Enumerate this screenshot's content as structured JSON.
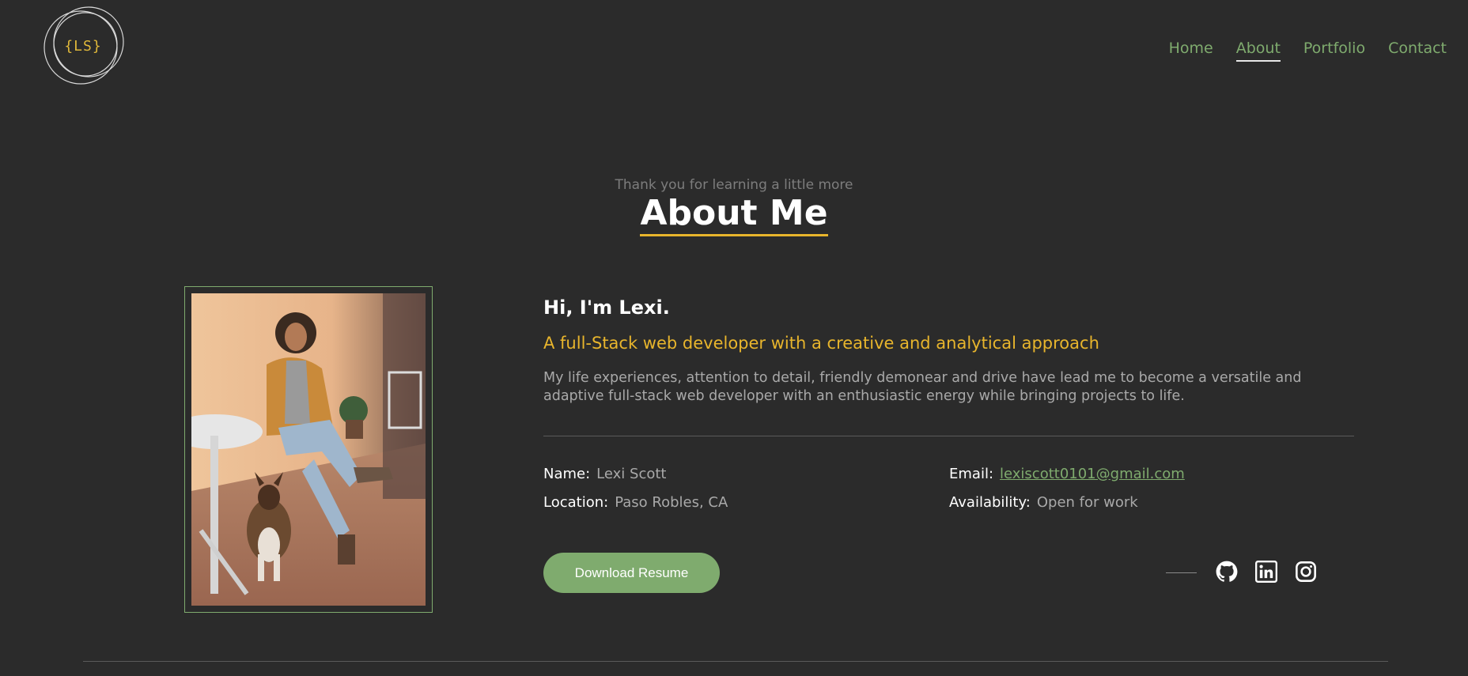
{
  "header": {
    "logo_text": "{LS}",
    "nav": [
      {
        "label": "Home",
        "active": false
      },
      {
        "label": "About",
        "active": true
      },
      {
        "label": "Portfolio",
        "active": false
      },
      {
        "label": "Contact",
        "active": false
      }
    ]
  },
  "about": {
    "subtitle": "Thank you for learning a little more",
    "title": "About Me",
    "greeting": "Hi, I'm Lexi.",
    "tagline": "A full-Stack web developer with a creative and analytical approach",
    "description": "My life experiences, attention to detail, friendly demonear and drive have lead me to become a versatile and adaptive full-stack web developer with an enthusiastic energy while bringing projects to life.",
    "info": {
      "name_label": "Name:",
      "name_value": "Lexi Scott",
      "location_label": "Location:",
      "location_value": "Paso Robles, CA",
      "email_label": "Email:",
      "email_value": "lexiscott0101@gmail.com",
      "availability_label": "Availability:",
      "availability_value": "Open for work"
    },
    "download_label": "Download Resume",
    "social_icons": [
      "github-icon",
      "linkedin-icon",
      "instagram-icon"
    ]
  },
  "colors": {
    "background": "#2b2b2b",
    "accent_green": "#7fab6e",
    "accent_yellow": "#e8b52c",
    "text_muted": "#a9a9a9"
  }
}
